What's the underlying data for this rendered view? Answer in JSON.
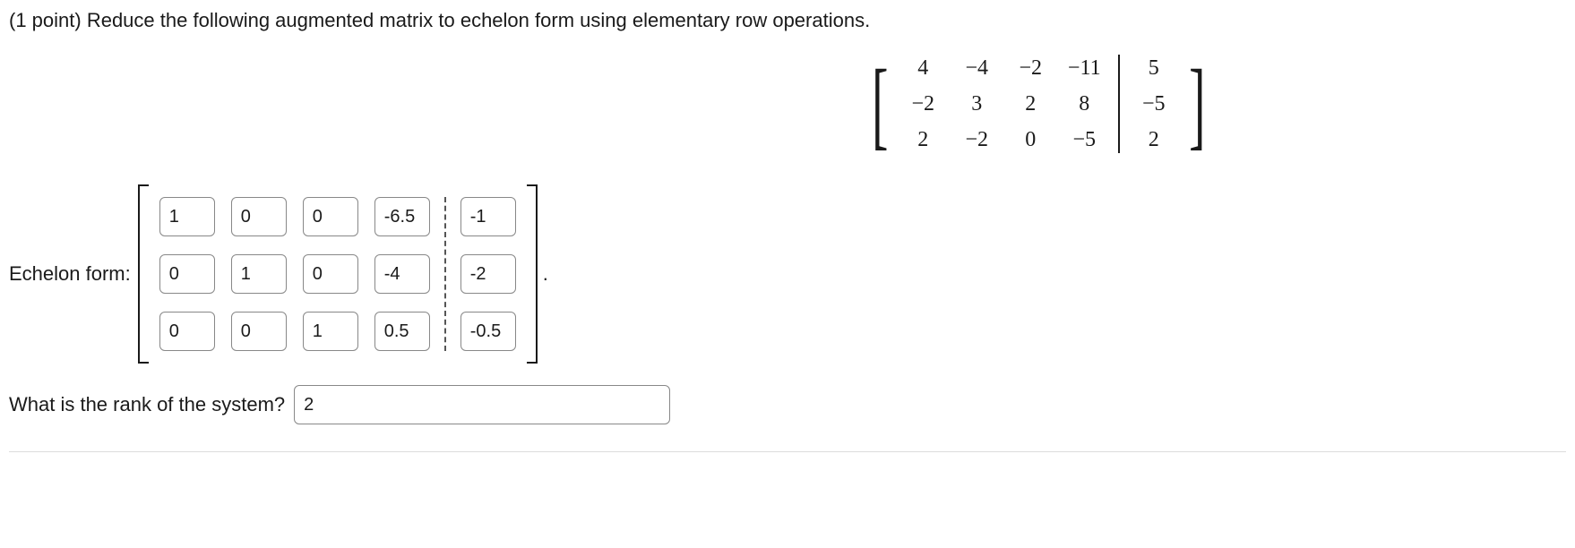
{
  "question": {
    "points_prefix": "(1 point) ",
    "text": "Reduce the following augmented matrix to echelon form using elementary row operations."
  },
  "given_matrix": {
    "left": [
      [
        "4",
        "−4",
        "−2",
        "−11"
      ],
      [
        "−2",
        "3",
        "2",
        "8"
      ],
      [
        "2",
        "−2",
        "0",
        "−5"
      ]
    ],
    "right": [
      [
        "5"
      ],
      [
        "−5"
      ],
      [
        "2"
      ]
    ]
  },
  "echelon": {
    "label": "Echelon form:",
    "answers_left": [
      [
        "1",
        "0",
        "0",
        "-6.5"
      ],
      [
        "0",
        "1",
        "0",
        "-4"
      ],
      [
        "0",
        "0",
        "1",
        "0.5"
      ]
    ],
    "answers_right": [
      [
        "-1"
      ],
      [
        "-2"
      ],
      [
        "-0.5"
      ]
    ],
    "trailing": "."
  },
  "rank": {
    "label": "What is the rank of the system?",
    "value": "2"
  }
}
